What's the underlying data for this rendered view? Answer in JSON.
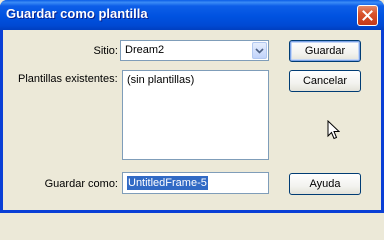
{
  "window": {
    "title": "Guardar como plantilla"
  },
  "form": {
    "sitio_label": "Sitio:",
    "sitio_value": "Dream2",
    "plantillas_label": "Plantillas existentes:",
    "plantillas_items": [
      "(sin plantillas)"
    ],
    "guardar_como_label": "Guardar como:",
    "guardar_como_value": "UntitledFrame-5"
  },
  "buttons": {
    "guardar": "Guardar",
    "cancelar": "Cancelar",
    "ayuda": "Ayuda"
  },
  "colors": {
    "titlebar": "#0054e3",
    "dialog_bg": "#ece9d8",
    "selection": "#316ac5",
    "close_button": "#d9532c"
  },
  "icons": [
    "close-icon",
    "chevron-down-icon",
    "mouse-pointer-icon"
  ]
}
